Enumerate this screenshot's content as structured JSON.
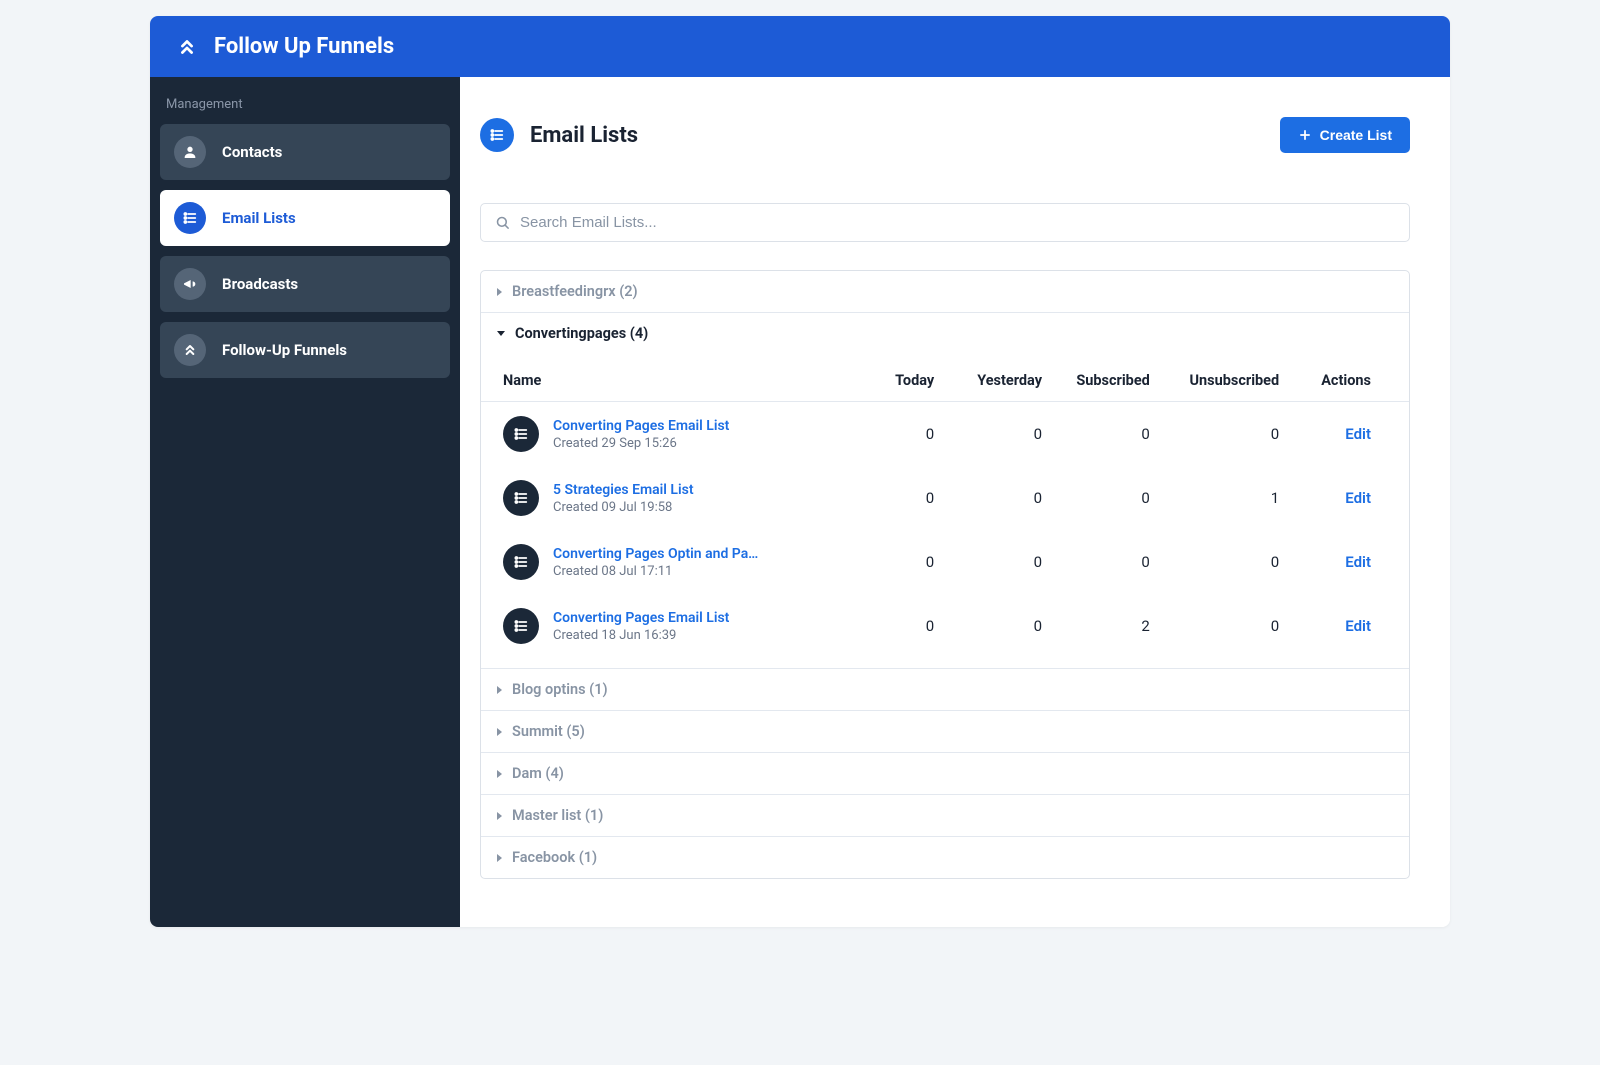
{
  "header": {
    "title": "Follow Up Funnels"
  },
  "sidebar": {
    "section_label": "Management",
    "items": [
      {
        "label": "Contacts",
        "icon": "user",
        "active": false
      },
      {
        "label": "Email Lists",
        "icon": "list",
        "active": true
      },
      {
        "label": "Broadcasts",
        "icon": "megaphone",
        "active": false
      },
      {
        "label": "Follow-Up Funnels",
        "icon": "chevrons",
        "active": false
      }
    ]
  },
  "page": {
    "title": "Email Lists",
    "create_button": "Create List",
    "search_placeholder": "Search Email Lists..."
  },
  "columns": {
    "name": "Name",
    "today": "Today",
    "yesterday": "Yesterday",
    "subscribed": "Subscribed",
    "unsubscribed": "Unsubscribed",
    "actions": "Actions"
  },
  "labels": {
    "created_prefix": "Created",
    "edit": "Edit"
  },
  "groups": [
    {
      "name": "Breastfeedingrx",
      "count": 2,
      "expanded": false
    },
    {
      "name": "Convertingpages",
      "count": 4,
      "expanded": true,
      "rows": [
        {
          "name": "Converting Pages Email List",
          "created": "29 Sep 15:26",
          "today": 0,
          "yesterday": 0,
          "subscribed": 0,
          "unsubscribed": 0
        },
        {
          "name": "5 Strategies Email List",
          "created": "09 Jul 19:58",
          "today": 0,
          "yesterday": 0,
          "subscribed": 0,
          "unsubscribed": 1
        },
        {
          "name": "Converting Pages Optin and Pay…",
          "created": "08 Jul 17:11",
          "today": 0,
          "yesterday": 0,
          "subscribed": 0,
          "unsubscribed": 0
        },
        {
          "name": "Converting Pages Email List",
          "created": "18 Jun 16:39",
          "today": 0,
          "yesterday": 0,
          "subscribed": 2,
          "unsubscribed": 0
        }
      ]
    },
    {
      "name": "Blog optins",
      "count": 1,
      "expanded": false
    },
    {
      "name": "Summit",
      "count": 5,
      "expanded": false
    },
    {
      "name": "Dam",
      "count": 4,
      "expanded": false
    },
    {
      "name": "Master list",
      "count": 1,
      "expanded": false
    },
    {
      "name": "Facebook",
      "count": 1,
      "expanded": false
    }
  ]
}
